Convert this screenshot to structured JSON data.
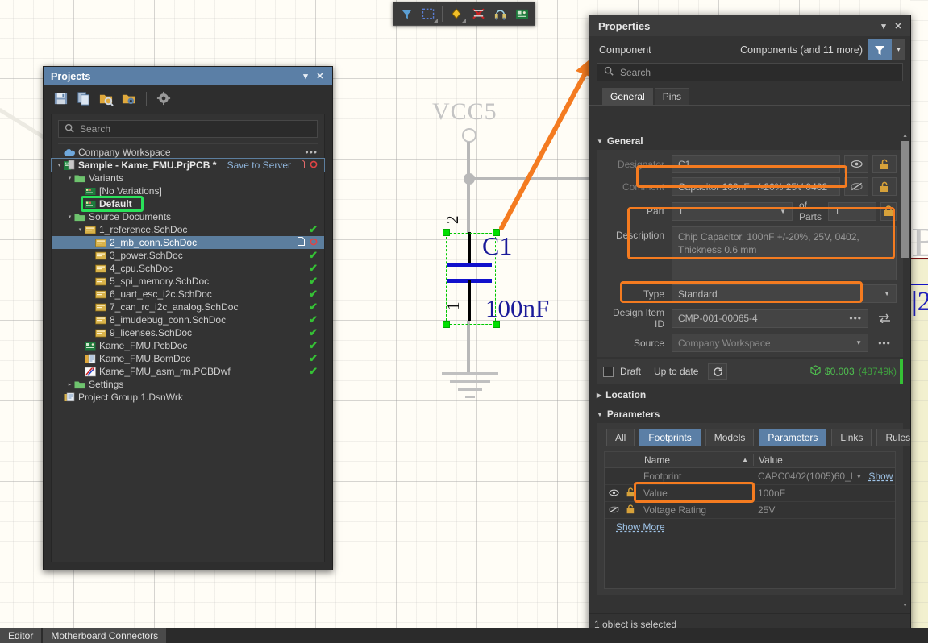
{
  "canvas": {
    "net_label": "VCC5",
    "designator": "C1",
    "value_label": "100nF",
    "pin1": "1",
    "pin2": "2",
    "right_edge_ghost_letter": "B",
    "right_edge_ghost_number": "|2"
  },
  "mini_toolbar": {
    "buttons": [
      {
        "name": "filter-icon",
        "label": "Filter"
      },
      {
        "name": "selection-rectangle-icon",
        "label": "Selection"
      },
      {
        "name": "place-part-icon",
        "label": "Place Part"
      },
      {
        "name": "clear-net-icon",
        "label": "Clear Net"
      },
      {
        "name": "net-connect-icon",
        "label": "Net Connect"
      },
      {
        "name": "pcb-board-icon",
        "label": "PCB"
      }
    ]
  },
  "projects": {
    "title": "Projects",
    "collapse_label": "▾",
    "close_label": "✕",
    "toolbar": [
      {
        "name": "save-icon",
        "label": "Save"
      },
      {
        "name": "copy-icon",
        "label": "Copy"
      },
      {
        "name": "open-project-icon",
        "label": "Open Project"
      },
      {
        "name": "project-options-icon",
        "label": "Project Options"
      },
      {
        "name": "gear-icon",
        "label": "Settings"
      }
    ],
    "search_placeholder": "Search",
    "tree": [
      {
        "label": "Company Workspace",
        "depth": 0,
        "icon": "cloud-icon",
        "twisty": "",
        "status": "",
        "trailing": "dots"
      },
      {
        "label": "Sample - Kame_FMU.PrjPCB *",
        "depth": 0,
        "icon": "project-icon",
        "twisty": "▾",
        "status": "",
        "trailing": "save-to-server",
        "bold": true,
        "outlined": true
      },
      {
        "label": "Variants",
        "depth": 1,
        "icon": "folder-icon",
        "twisty": "▾",
        "status": ""
      },
      {
        "label": "[No Variations]",
        "depth": 2,
        "icon": "variant-icon",
        "twisty": "",
        "status": ""
      },
      {
        "label": "Default",
        "depth": 2,
        "icon": "variant-icon",
        "twisty": "",
        "status": "",
        "bold": true,
        "green_highlight": true
      },
      {
        "label": "Source Documents",
        "depth": 1,
        "icon": "folder-icon",
        "twisty": "▾",
        "status": ""
      },
      {
        "label": "1_reference.SchDoc",
        "depth": 2,
        "icon": "sch-icon",
        "twisty": "▾",
        "status": "✔"
      },
      {
        "label": "2_mb_conn.SchDoc",
        "depth": 3,
        "icon": "sch-icon",
        "twisty": "",
        "status": "modified",
        "selected": true
      },
      {
        "label": "3_power.SchDoc",
        "depth": 3,
        "icon": "sch-icon",
        "twisty": "",
        "status": "✔"
      },
      {
        "label": "4_cpu.SchDoc",
        "depth": 3,
        "icon": "sch-icon",
        "twisty": "",
        "status": "✔"
      },
      {
        "label": "5_spi_memory.SchDoc",
        "depth": 3,
        "icon": "sch-icon",
        "twisty": "",
        "status": "✔"
      },
      {
        "label": "6_uart_esc_i2c.SchDoc",
        "depth": 3,
        "icon": "sch-icon",
        "twisty": "",
        "status": "✔"
      },
      {
        "label": "7_can_rc_i2c_analog.SchDoc",
        "depth": 3,
        "icon": "sch-icon",
        "twisty": "",
        "status": "✔"
      },
      {
        "label": "8_imudebug_conn.SchDoc",
        "depth": 3,
        "icon": "sch-icon",
        "twisty": "",
        "status": "✔"
      },
      {
        "label": "9_licenses.SchDoc",
        "depth": 3,
        "icon": "sch-icon",
        "twisty": "",
        "status": "✔"
      },
      {
        "label": "Kame_FMU.PcbDoc",
        "depth": 2,
        "icon": "pcb-icon",
        "twisty": "",
        "status": "✔"
      },
      {
        "label": "Kame_FMU.BomDoc",
        "depth": 2,
        "icon": "bom-icon",
        "twisty": "",
        "status": "✔"
      },
      {
        "label": "Kame_FMU_asm_rm.PCBDwf",
        "depth": 2,
        "icon": "draftsman-icon",
        "twisty": "",
        "status": "✔"
      },
      {
        "label": "Settings",
        "depth": 1,
        "icon": "folder-icon",
        "twisty": "▸",
        "status": ""
      },
      {
        "label": "Project Group 1.DsnWrk",
        "depth": 0,
        "icon": "workspace-icon",
        "twisty": "",
        "status": ""
      }
    ],
    "save_to_server": "Save to Server"
  },
  "properties": {
    "title": "Properties",
    "collapse_label": "▾",
    "close_label": "✕",
    "object_type": "Component",
    "selection_summary": "Components (and 11 more)",
    "search_placeholder": "Search",
    "tabs": [
      {
        "label": "General",
        "active": true
      },
      {
        "label": "Pins",
        "active": false
      }
    ],
    "general": {
      "section_label": "General",
      "designator_label": "Designator",
      "designator_value": "C1",
      "comment_label": "Comment",
      "comment_value": "Capacitor 100nF +/-20% 25V 0402",
      "part_label": "Part",
      "part_value": "1",
      "of_parts_label": "of Parts",
      "of_parts_value": "1",
      "description_label": "Description",
      "description_value": "Chip Capacitor, 100nF +/-20%, 25V, 0402, Thickness 0.6 mm",
      "type_label": "Type",
      "type_value": "Standard",
      "design_item_id_label": "Design Item ID",
      "design_item_id_value": "CMP-001-00065-4",
      "source_label": "Source",
      "source_value": "Company Workspace",
      "draft_label": "Draft",
      "up_to_date_label": "Up to date",
      "cost_value": "$0.003",
      "stock_value": "(48749k)"
    },
    "location": {
      "section_label": "Location"
    },
    "parameters": {
      "section_label": "Parameters",
      "filters": [
        {
          "label": "All",
          "on": false
        },
        {
          "label": "Footprints",
          "on": true
        },
        {
          "label": "Models",
          "on": false
        },
        {
          "label": "Parameters",
          "on": true
        },
        {
          "label": "Links",
          "on": false
        },
        {
          "label": "Rules",
          "on": false
        }
      ],
      "columns": [
        "Name",
        "Value"
      ],
      "sort_indicator": "▲",
      "rows": [
        {
          "eye": "",
          "lock": "",
          "name": "Footprint",
          "value": "CAPC0402(1005)60_L",
          "dropdown": true,
          "show_link": "Show"
        },
        {
          "eye": "visible",
          "lock": "unlocked",
          "name": "Value",
          "value": "100nF",
          "dropdown": false,
          "show_link": ""
        },
        {
          "eye": "hidden",
          "lock": "unlocked",
          "name": "Voltage Rating",
          "value": "25V",
          "dropdown": false,
          "show_link": "",
          "orange_highlight": true
        }
      ],
      "show_more": "Show More"
    },
    "status": "1 object is selected"
  },
  "statusbar": {
    "items": [
      {
        "label": "Editor"
      },
      {
        "label": "Motherboard Connectors"
      }
    ]
  },
  "colors": {
    "accent_blue": "#5b7fa6",
    "highlight_orange": "#f47b20",
    "highlight_green": "#2ae25a",
    "ok_green": "#35c135",
    "panel_bg": "#333333"
  }
}
